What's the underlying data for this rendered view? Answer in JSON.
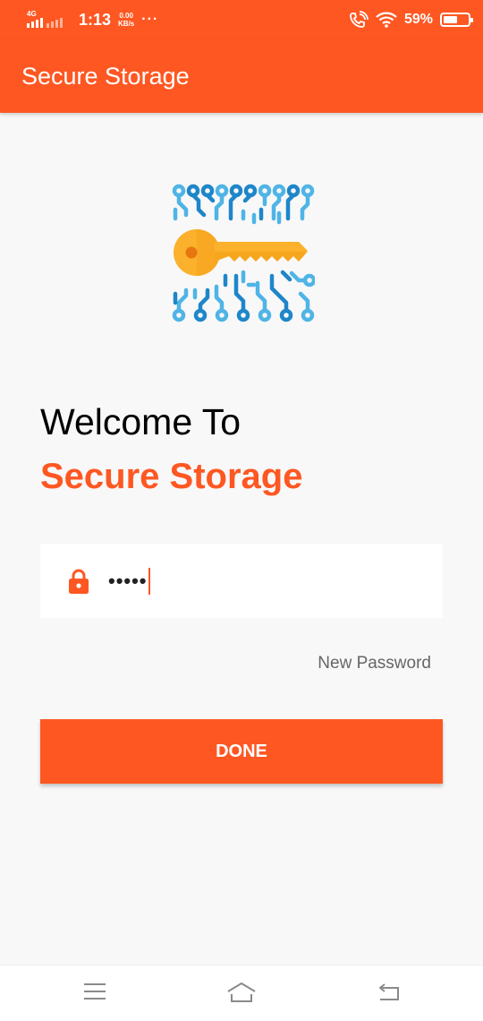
{
  "status_bar": {
    "network": "4G",
    "time": "1:13",
    "speed_value": "0.00",
    "speed_unit": "KB/s",
    "more": "···",
    "battery_percent": "59%",
    "battery_level": 0.59
  },
  "app_bar": {
    "title": "Secure Storage"
  },
  "main": {
    "logo_icon": "key-circuit-icon",
    "welcome": "Welcome To",
    "brand": "Secure Storage",
    "password": {
      "icon": "lock-icon",
      "value": "•••••"
    },
    "new_password_link": "New Password",
    "done_button": "DONE"
  },
  "nav_bar": {
    "items": [
      "menu-icon",
      "home-icon",
      "back-icon"
    ]
  },
  "colors": {
    "primary": "#fe5722",
    "key": "#fbb12b",
    "circuit_light": "#4fb4e6",
    "circuit_dark": "#1e86c9"
  }
}
